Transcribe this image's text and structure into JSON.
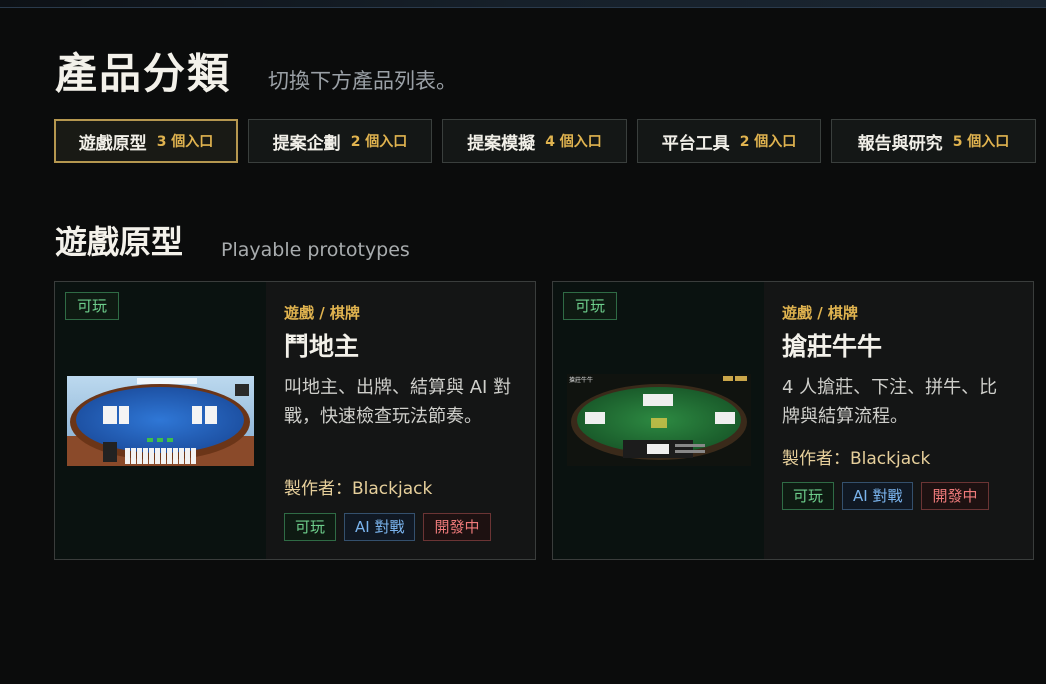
{
  "hero": {
    "title": "產品分類",
    "subtitle": "切換下方產品列表。"
  },
  "tabs": [
    {
      "name": "遊戲原型",
      "count": "3 個入口",
      "active": true
    },
    {
      "name": "提案企劃",
      "count": "2 個入口",
      "active": false
    },
    {
      "name": "提案模擬",
      "count": "4 個入口",
      "active": false
    },
    {
      "name": "平台工具",
      "count": "2 個入口",
      "active": false
    },
    {
      "name": "報告與研究",
      "count": "5 個入口",
      "active": false
    }
  ],
  "section": {
    "title": "遊戲原型",
    "subtitle": "Playable prototypes"
  },
  "cards": [
    {
      "state": "可玩",
      "category": "遊戲 / 棋牌",
      "name": "鬥地主",
      "description": "叫地主、出牌、結算與 AI 對戰，快速檢查玩法節奏。",
      "maker": "製作者：Blackjack",
      "tags": [
        "可玩",
        "AI 對戰",
        "開發中"
      ],
      "thumb_title": ""
    },
    {
      "state": "可玩",
      "category": "遊戲 / 棋牌",
      "name": "搶莊牛牛",
      "description": "4 人搶莊、下注、拼牛、比牌與結算流程。",
      "maker": "製作者：Blackjack",
      "tags": [
        "可玩",
        "AI 對戰",
        "開發中"
      ],
      "thumb_title": "搶莊牛牛"
    }
  ],
  "colors": {
    "accent_gold": "#e0b34f",
    "active_border": "#b5974f",
    "tag_green": "#6ecf8c",
    "tag_blue": "#7ab4ee",
    "tag_red": "#ee7a7a"
  }
}
